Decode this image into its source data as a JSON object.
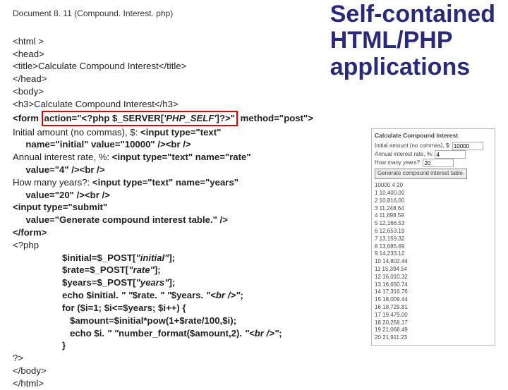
{
  "doc_label": "Document 8. 11 (Compound. Interest. php)",
  "headline_l1": "Self-contained",
  "headline_l2": "HTML/PHP",
  "headline_l3": "applications",
  "code": {
    "l1": "<html >",
    "l2": "<head>",
    "l3a": "<title>",
    "l3b": "Calculate Compound Interest",
    "l3c": "</title>",
    "l4": "</head>",
    "l5": "<body>",
    "l6a": "<h3>",
    "l6b": "Calculate Compound Interest",
    "l6c": "</h3>",
    "l7a": "<form ",
    "l7b": "action=\"<?php $_SERVER[",
    "l7c": "'PHP_SELF'",
    "l7d": "]?>\"",
    "l7e": " method=\"post\">",
    "l8a": "Initial amount (no commas), $: ",
    "l8b": "<input type=\"text\"",
    "l9": "     name=\"initial\" value=\"10000\" /><br />",
    "l10a": "Annual interest rate, %: ",
    "l10b": "<input type=\"text\" name=\"rate\"",
    "l11": "     value=\"4\" /><br />",
    "l12a": "How many years?: ",
    "l12b": "<input type=\"text\" name=\"years\"",
    "l13": "     value=\"20\" /><br />",
    "l14": "<input type=\"submit\"",
    "l15": "     value=\"Generate compound interest table.\" />",
    "l16": "</form>",
    "l17": "<?php",
    "p1a": "$initial=$_POST[",
    "p1b": "\"initial\"",
    "p1c": "];",
    "p2a": "$rate=$_POST[",
    "p2b": "\"rate\"",
    "p2c": "];",
    "p3a": "$years=$_POST[",
    "p3b": "\"years\"",
    "p3c": "];",
    "p4a": "echo $initial. ",
    "p4b": "\" \"",
    "p4c": "$rate. ",
    "p4d": "\" \"",
    "p4e": "$years. ",
    "p4f": "\"<br />\"",
    "p4g": ";",
    "p5": "for ($i=1; $i<=$years; $i++) {",
    "p6": "   $amount=$initial*pow(1+$rate/100,$i);",
    "p7a": "   echo $i. ",
    "p7b": "\" \"",
    "p7c": "number_format($amount,2). ",
    "p7d": "\"<br />\"",
    "p7e": ";",
    "p8": "}",
    "l18": "?>",
    "l19": "</body>",
    "l20": "</html>"
  },
  "preview": {
    "heading": "Calculate Compound Interest",
    "f1_label": "Initial amount (no commas), $:",
    "f1_val": "10000",
    "f2_label": "Annual interest rate, %:",
    "f2_val": "4",
    "f3_label": "How many years?:",
    "f3_val": "20",
    "button": "Generate compound interest table.",
    "topline": "10000 4 20",
    "rows": [
      "1 10,400.00",
      "2 10,816.00",
      "3 11,248.64",
      "4 11,698.59",
      "5 12,166.53",
      "6 12,653.19",
      "7 13,159.32",
      "8 13,685.69",
      "9 14,233.12",
      "10 14,802.44",
      "11 15,394.54",
      "12 16,010.32",
      "13 16,650.74",
      "14 17,316.76",
      "15 18,009.44",
      "16 18,729.81",
      "17 19,479.00",
      "18 20,258.17",
      "19 21,068.49",
      "20 21,911.23"
    ]
  }
}
